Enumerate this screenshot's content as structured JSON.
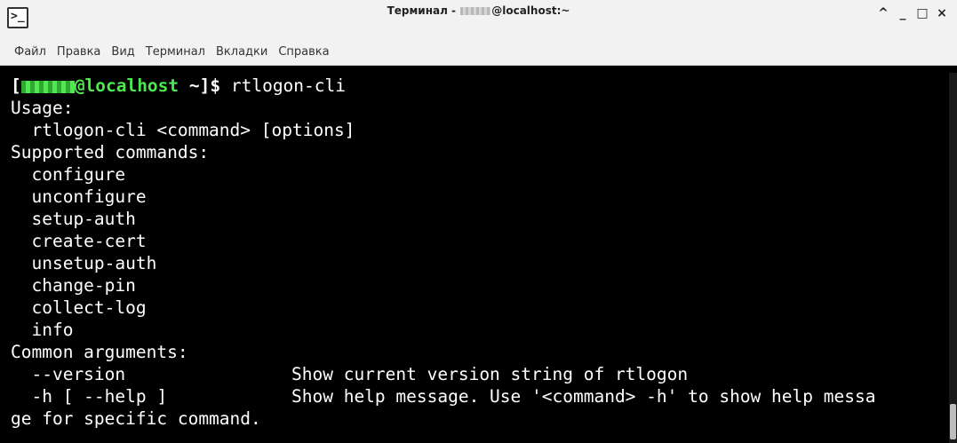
{
  "window": {
    "title_prefix": "Терминал - ",
    "title_suffix": "@localhost:~",
    "controls": [
      "^",
      "_",
      "□",
      "×"
    ],
    "icon": "terminal-icon"
  },
  "menu": [
    "Файл",
    "Правка",
    "Вид",
    "Терминал",
    "Вкладки",
    "Справка"
  ],
  "terminal": {
    "prompt_open": "[",
    "prompt_host": "@localhost",
    "prompt_rest": " ~]$ ",
    "command": "rtlogon-cli",
    "lines": [
      "Usage:",
      "  rtlogon-cli <command> [options]",
      "Supported commands:",
      "  configure",
      "  unconfigure",
      "  setup-auth",
      "  create-cert",
      "  unsetup-auth",
      "  change-pin",
      "  collect-log",
      "  info",
      "Common arguments:"
    ],
    "args": [
      {
        "flag": "  --version",
        "desc": "Show current version string of rtlogon"
      },
      {
        "flag": "  -h [ --help ]",
        "desc": "Show help message. Use '<command> -h' to show help messa"
      }
    ],
    "wrap_line": "ge for specific command."
  }
}
